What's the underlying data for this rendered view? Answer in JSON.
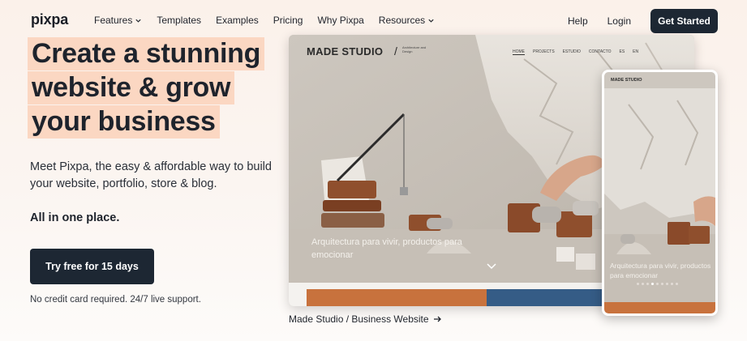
{
  "nav": {
    "logo": "pixpa",
    "links": [
      {
        "label": "Features",
        "dropdown": true
      },
      {
        "label": "Templates",
        "dropdown": false
      },
      {
        "label": "Examples",
        "dropdown": false
      },
      {
        "label": "Pricing",
        "dropdown": false
      },
      {
        "label": "Why Pixpa",
        "dropdown": false
      },
      {
        "label": "Resources",
        "dropdown": true
      }
    ],
    "help": "Help",
    "login": "Login",
    "cta": "Get Started"
  },
  "hero": {
    "headline_lines": [
      "Create a stunning",
      "website & grow",
      "your business"
    ],
    "description": "Meet Pixpa, the easy & affordable way to build your website, portfolio, store & blog.",
    "description_strong": "All in one place.",
    "cta": "Try free for 15 days",
    "note": "No credit card required. 24/7 live support."
  },
  "preview": {
    "desktop_brand": "MADE STUDIO",
    "desktop_sub": "Architecture and Design",
    "desktop_nav": [
      "HOME",
      "PROJECTS",
      "ESTUDIO",
      "CONTACTO",
      "ES",
      "EN"
    ],
    "caption": "Arquitectura para vivir, productos para emocionar",
    "mobile_brand": "MADE STUDIO",
    "link_label": "Made Studio / Business Website"
  },
  "colors": {
    "highlight": "#fbd7c2",
    "dark_button": "#1d2733",
    "strip_orange": "#c8723d",
    "strip_blue": "#355c86"
  }
}
